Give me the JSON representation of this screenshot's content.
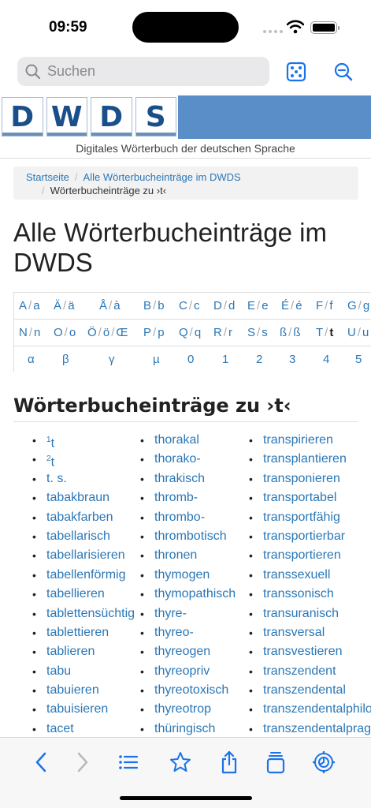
{
  "status": {
    "time": "09:59"
  },
  "search": {
    "placeholder": "Suchen"
  },
  "colors": {
    "accent": "#2a77b6",
    "banner": "#5a8ec8",
    "ios_blue": "#1a73e8"
  },
  "logo": {
    "letters": [
      "D",
      "W",
      "D",
      "S"
    ]
  },
  "tagline": "Digitales Wörterbuch der deutschen Sprache",
  "breadcrumb": {
    "home": "Startseite",
    "all": "Alle Wörterbucheinträge im DWDS",
    "current": "Wörterbucheinträge zu ›t‹",
    "separator": "/"
  },
  "page_title": "Alle Wörterbucheinträge im DWDS",
  "letter_index": {
    "row1": [
      "A",
      "a",
      "Ä",
      "ä",
      "Å",
      "à",
      "B",
      "b",
      "C",
      "c",
      "D",
      "d",
      "E",
      "e",
      "É",
      "é",
      "F",
      "f",
      "G",
      "g"
    ],
    "row2": [
      "N",
      "n",
      "O",
      "o",
      "Ö",
      "ö",
      "Œ",
      "P",
      "p",
      "Q",
      "q",
      "R",
      "r",
      "S",
      "s",
      "ß",
      "ß",
      "T",
      "t",
      "U",
      "u"
    ],
    "row3": [
      "α",
      "β",
      "γ",
      "µ",
      "0",
      "1",
      "2",
      "3",
      "4",
      "5"
    ]
  },
  "section_title": "Wörterbucheinträge zu ›t‹",
  "entries": {
    "col1": [
      "t",
      "t",
      "t. s.",
      "tabakbraun",
      "tabakfarben",
      "tabellarisch",
      "tabellarisieren",
      "tabellenförmig",
      "tabellieren",
      "tablettensüchtig",
      "tablettieren",
      "tablieren",
      "tabu",
      "tabuieren",
      "tabuisieren",
      "tacet"
    ],
    "col1_sup": [
      "1",
      "2"
    ],
    "col2": [
      "thorakal",
      "thorako-",
      "thrakisch",
      "thromb-",
      "thrombo-",
      "thrombotisch",
      "thronen",
      "thymogen",
      "thymopathisch",
      "thyre-",
      "thyreo-",
      "thyreogen",
      "thyreopriv",
      "thyreotoxisch",
      "thyreotrop",
      "thüringisch"
    ],
    "col3": [
      "transpirieren",
      "transplantieren",
      "transponieren",
      "transportabel",
      "transportfähig",
      "transportierbar",
      "transportieren",
      "transsexuell",
      "transsonisch",
      "transuranisch",
      "transversal",
      "transvestieren",
      "transzendent",
      "transzendental",
      "transzendentalphilo",
      "transzendentalprag"
    ]
  },
  "toolbar_icons": [
    "back-chevron-icon",
    "forward-chevron-icon",
    "list-icon",
    "star-icon",
    "share-icon",
    "tabs-icon",
    "settings-icon"
  ]
}
